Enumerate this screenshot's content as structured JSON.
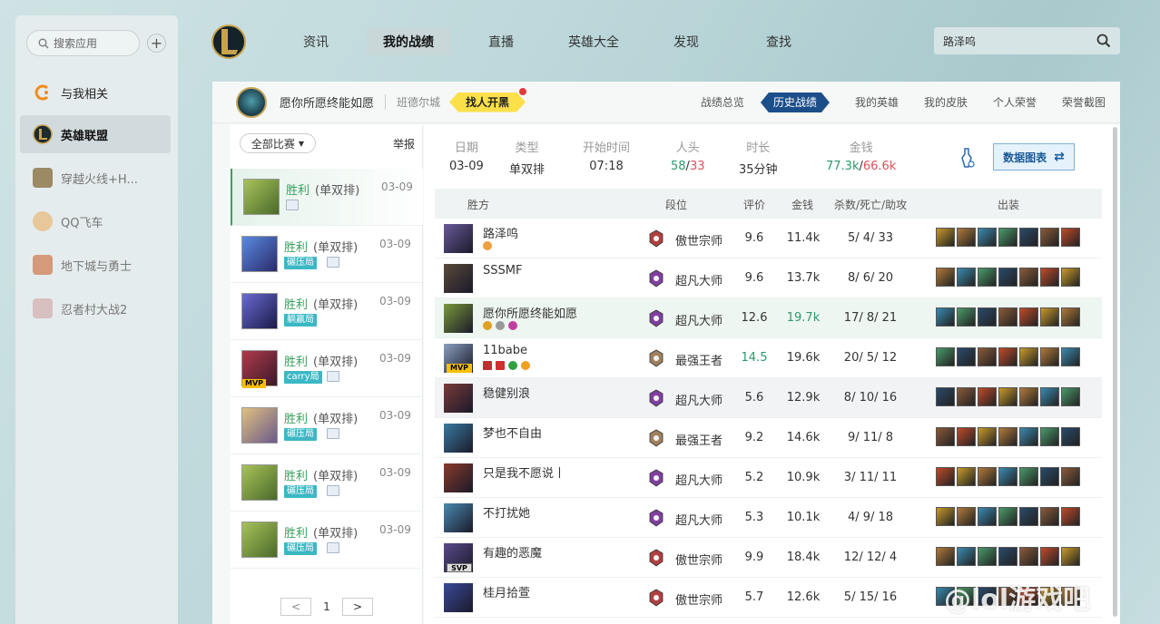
{
  "sidebar": {
    "search_placeholder": "搜索应用",
    "add_label": "+",
    "items": [
      {
        "label": "与我相关",
        "color": "#f28c1c",
        "icon": "orange-c-icon"
      },
      {
        "label": "英雄联盟",
        "color": "#c9a24a",
        "icon": "lol-icon"
      },
      {
        "label": "穿越火线+H...",
        "color": "#9c8a64",
        "icon": "cf-icon"
      },
      {
        "label": "QQ飞车",
        "color": "#e8c79a",
        "icon": "qq-speed-icon"
      },
      {
        "label": "地下城与勇士",
        "color": "#d49a7a",
        "icon": "dnf-icon"
      },
      {
        "label": "忍者村大战2",
        "color": "#d8bfc0",
        "icon": "ninja-icon"
      }
    ]
  },
  "topnav": {
    "tabs": [
      "资讯",
      "我的战绩",
      "直播",
      "英雄大全",
      "发现",
      "查找"
    ],
    "search_value": "路泽呜"
  },
  "player": {
    "name": "愿你所愿终能如愿",
    "server": "班德尔城",
    "find_btn": "找人开黑"
  },
  "panel_tabs": [
    "战绩总览",
    "历史战绩",
    "我的英雄",
    "我的皮肤",
    "个人荣誉",
    "荣誉截图"
  ],
  "match_list": {
    "filter": "全部比赛",
    "report": "举报",
    "matches": [
      {
        "result": "胜利",
        "mode": "(单双排)",
        "date": "03-09",
        "tag": "",
        "color": "#7a9a3a"
      },
      {
        "result": "胜利",
        "mode": "(单双排)",
        "date": "03-09",
        "tag": "碾压局",
        "color": "#3a6abf"
      },
      {
        "result": "胜利",
        "mode": "(单双排)",
        "date": "03-09",
        "tag": "躺赢局",
        "color": "#4a4ab0"
      },
      {
        "result": "胜利",
        "mode": "(单双排)",
        "date": "03-09",
        "tag": "carry局",
        "color": "#8a2a3a",
        "mvp": "MVP"
      },
      {
        "result": "胜利",
        "mode": "(单双排)",
        "date": "03-09",
        "tag": "碾压局",
        "color": "#c8a060"
      },
      {
        "result": "胜利",
        "mode": "(单双排)",
        "date": "03-09",
        "tag": "碾压局",
        "color": "#7a9a3a"
      },
      {
        "result": "胜利",
        "mode": "(单双排)",
        "date": "03-09",
        "tag": "碾压局",
        "color": "#7a9a3a"
      }
    ],
    "page": "1",
    "prev": "<",
    "next": ">"
  },
  "summary": {
    "labels": [
      "日期",
      "类型",
      "开始时间",
      "人头",
      "时长",
      "金钱"
    ],
    "date": "03-09",
    "type": "单双排",
    "start": "07:18",
    "kills_team": "58",
    "kills_sep": "/",
    "kills_enemy": "33",
    "duration": "35分钟",
    "gold_team": "77.3k",
    "gold_sep": "/",
    "gold_enemy": "66.6k",
    "data_btn": "数据图表"
  },
  "table": {
    "headers": [
      "胜方",
      "段位",
      "评价",
      "金钱",
      "杀数/死亡/助攻",
      "出装"
    ],
    "rows": [
      {
        "name": "路泽呜",
        "rank": "傲世宗师",
        "score": "9.6",
        "gold": "11.4k",
        "kda": "5/ 4/ 33",
        "color": "#6a5a9a",
        "rank_color": "#b04040"
      },
      {
        "name": "SSSMF",
        "rank": "超凡大师",
        "score": "9.6",
        "gold": "13.7k",
        "kda": "8/ 6/ 20",
        "color": "#5a4a3a",
        "rank_color": "#8040a0"
      },
      {
        "name": "愿你所愿终能如愿",
        "rank": "超凡大师",
        "score": "12.6",
        "gold": "19.7k",
        "kda": "17/ 8/ 21",
        "color": "#7a9a3a",
        "rank_color": "#8040a0"
      },
      {
        "name": "11babe",
        "rank": "最强王者",
        "score": "14.5",
        "gold": "19.6k",
        "kda": "20/ 5/ 12",
        "color": "#8aa0c0",
        "rank_color": "#a08060",
        "mvp": "MVP"
      },
      {
        "name": "稳健别浪",
        "rank": "超凡大师",
        "score": "5.6",
        "gold": "12.9k",
        "kda": "8/ 10/ 16",
        "color": "#7a3a3a",
        "rank_color": "#8040a0"
      },
      {
        "name": "梦也不自由",
        "rank": "最强王者",
        "score": "9.2",
        "gold": "14.6k",
        "kda": "9/ 11/ 8",
        "color": "#3a7aa0",
        "rank_color": "#a08060"
      },
      {
        "name": "只是我不愿说丨",
        "rank": "超凡大师",
        "score": "5.2",
        "gold": "10.9k",
        "kda": "3/ 11/ 11",
        "color": "#8a3a2a",
        "rank_color": "#8040a0"
      },
      {
        "name": "不打扰她",
        "rank": "超凡大师",
        "score": "5.3",
        "gold": "10.1k",
        "kda": "4/ 9/ 18",
        "color": "#4a8ab0",
        "rank_color": "#8040a0"
      },
      {
        "name": "有趣的恶魔",
        "rank": "傲世宗师",
        "score": "9.9",
        "gold": "18.4k",
        "kda": "12/ 12/ 4",
        "color": "#5a4a8a",
        "rank_color": "#b04040",
        "svp": "SVP"
      },
      {
        "name": "桂月拾萱",
        "rank": "傲世宗师",
        "score": "5.7",
        "gold": "12.6k",
        "kda": "5/ 15/ 16",
        "color": "#3a4a9a",
        "rank_color": "#b04040"
      }
    ],
    "item_colors": [
      "#c89a2a",
      "#b07a3a",
      "#3a8ab0",
      "#4a9a6a",
      "#2a4a6a",
      "#8a5a3a",
      "#c04a2a"
    ]
  },
  "watermark": "@lol游戏吧",
  "colors": {
    "accent": "#1c4e8a",
    "win": "#3aa05f",
    "lose": "#e0505a",
    "tag": "#3bb8c4"
  }
}
